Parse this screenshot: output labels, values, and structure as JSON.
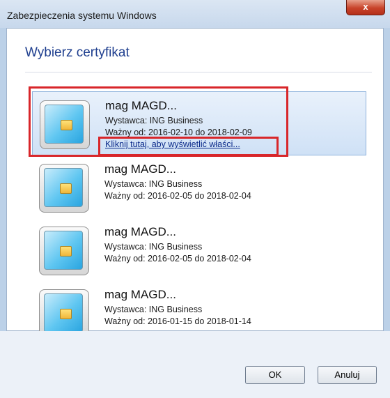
{
  "window": {
    "title": "Zabezpieczenia systemu Windows",
    "close_label": "x"
  },
  "dialog": {
    "heading": "Wybierz certyfikat"
  },
  "certificates": [
    {
      "name": "mag MAGD...",
      "issuer": "Wystawca: ING Business",
      "valid": "Ważny od: 2016-02-10 do 2018-02-09",
      "link": "Kliknij tutaj, aby wyświetlić właści...",
      "selected": true
    },
    {
      "name": "mag MAGD...",
      "issuer": "Wystawca: ING Business",
      "valid": "Ważny od: 2016-02-05 do 2018-02-04",
      "selected": false
    },
    {
      "name": "mag MAGD...",
      "issuer": "Wystawca: ING Business",
      "valid": "Ważny od: 2016-02-05 do 2018-02-04",
      "selected": false
    },
    {
      "name": "mag MAGD...",
      "issuer": "Wystawca: ING Business",
      "valid": "Ważny od: 2016-01-15 do 2018-01-14",
      "selected": false
    }
  ],
  "buttons": {
    "ok_label": "OK",
    "cancel_label": "Anuluj"
  },
  "colors": {
    "highlight": "#d8262a",
    "heading": "#1f3f8f",
    "selection": "#cfe1f6"
  },
  "icons": {
    "certificate": "smart-card-icon",
    "close": "close-icon"
  }
}
